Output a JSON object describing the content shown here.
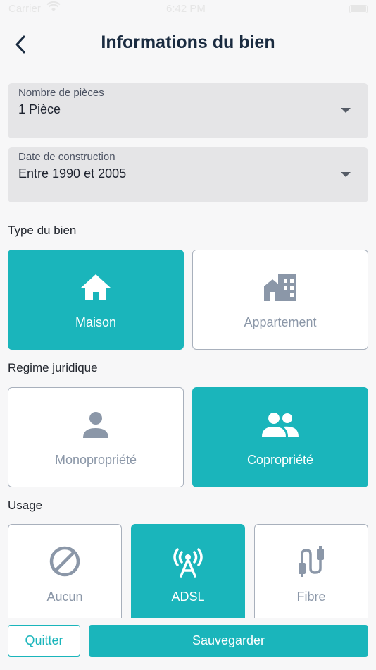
{
  "status_bar": {
    "carrier": "Carrier",
    "time": "6:42 PM"
  },
  "header": {
    "title": "Informations du bien"
  },
  "fields": {
    "rooms": {
      "label": "Nombre de pièces",
      "value": "1 Pièce"
    },
    "construction": {
      "label": "Date de construction",
      "value": "Entre 1990 et 2005"
    }
  },
  "property_type": {
    "label": "Type du bien",
    "options": [
      {
        "label": "Maison",
        "icon": "house-icon",
        "selected": true
      },
      {
        "label": "Appartement",
        "icon": "building-icon",
        "selected": false
      }
    ]
  },
  "legal_regime": {
    "label": "Regime juridique",
    "options": [
      {
        "label": "Monopropriété",
        "icon": "person-icon",
        "selected": false
      },
      {
        "label": "Copropriété",
        "icon": "people-icon",
        "selected": true
      }
    ]
  },
  "usage": {
    "label": "Usage",
    "options": [
      {
        "label": "Aucun",
        "icon": "block-icon",
        "selected": false
      },
      {
        "label": "ADSL",
        "icon": "antenna-icon",
        "selected": true
      },
      {
        "label": "Fibre",
        "icon": "cable-icon",
        "selected": false
      }
    ]
  },
  "actions": {
    "quit_label": "Quitter",
    "save_label": "Sauvegarder"
  },
  "colors": {
    "accent": "#1ab5bb",
    "title": "#1a2b40",
    "muted": "#8b97a8",
    "field_bg": "#e5e5e7"
  }
}
